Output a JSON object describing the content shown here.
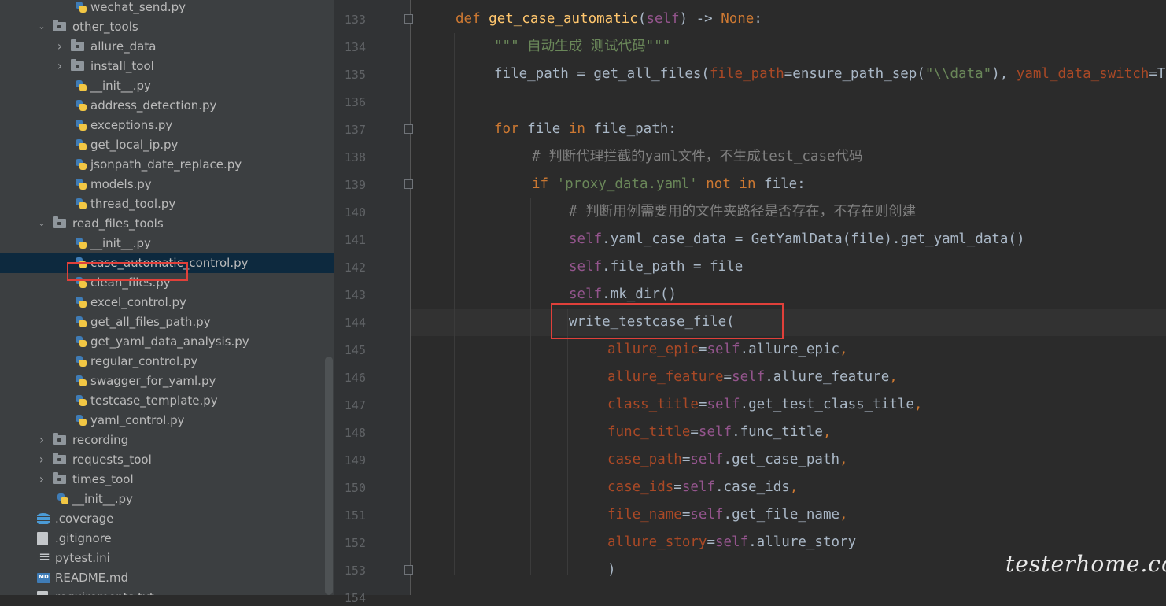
{
  "tree": {
    "items": [
      {
        "label": "wechat_send.py",
        "type": "py",
        "indent": 3
      },
      {
        "label": "other_tools",
        "type": "folder",
        "indent": 1,
        "open": true
      },
      {
        "label": "allure_data",
        "type": "folder",
        "indent": 2,
        "open": false
      },
      {
        "label": "install_tool",
        "type": "folder",
        "indent": 2,
        "open": false
      },
      {
        "label": "__init__.py",
        "type": "py",
        "indent": 3
      },
      {
        "label": "address_detection.py",
        "type": "py",
        "indent": 3
      },
      {
        "label": "exceptions.py",
        "type": "py",
        "indent": 3
      },
      {
        "label": "get_local_ip.py",
        "type": "py",
        "indent": 3
      },
      {
        "label": "jsonpath_date_replace.py",
        "type": "py",
        "indent": 3
      },
      {
        "label": "models.py",
        "type": "py",
        "indent": 3
      },
      {
        "label": "thread_tool.py",
        "type": "py",
        "indent": 3
      },
      {
        "label": "read_files_tools",
        "type": "folder",
        "indent": 1,
        "open": true
      },
      {
        "label": "__init__.py",
        "type": "py",
        "indent": 3
      },
      {
        "label": "case_automatic_control.py",
        "type": "py",
        "indent": 3,
        "selected": true
      },
      {
        "label": "clean_files.py",
        "type": "py",
        "indent": 3,
        "highlighted": true
      },
      {
        "label": "excel_control.py",
        "type": "py",
        "indent": 3
      },
      {
        "label": "get_all_files_path.py",
        "type": "py",
        "indent": 3
      },
      {
        "label": "get_yaml_data_analysis.py",
        "type": "py",
        "indent": 3
      },
      {
        "label": "regular_control.py",
        "type": "py",
        "indent": 3
      },
      {
        "label": "swagger_for_yaml.py",
        "type": "py",
        "indent": 3
      },
      {
        "label": "testcase_template.py",
        "type": "py",
        "indent": 3
      },
      {
        "label": "yaml_control.py",
        "type": "py",
        "indent": 3
      },
      {
        "label": "recording",
        "type": "folder",
        "indent": 1,
        "open": false
      },
      {
        "label": "requests_tool",
        "type": "folder",
        "indent": 1,
        "open": false
      },
      {
        "label": "times_tool",
        "type": "folder",
        "indent": 1,
        "open": false
      },
      {
        "label": "__init__.py",
        "type": "py",
        "indent": 2
      },
      {
        "label": ".coverage",
        "type": "db",
        "indent": 0
      },
      {
        "label": ".gitignore",
        "type": "file",
        "indent": 0
      },
      {
        "label": "pytest.ini",
        "type": "ini",
        "indent": 0
      },
      {
        "label": "README.md",
        "type": "md",
        "indent": 0
      },
      {
        "label": "requirements.txt",
        "type": "file",
        "indent": 0
      }
    ]
  },
  "editor": {
    "lines": [
      {
        "num": "133",
        "fold": true,
        "indent": 1,
        "tokens": [
          [
            "kw",
            "def "
          ],
          [
            "fn",
            "get_case_automatic"
          ],
          [
            "df",
            "("
          ],
          [
            "sf",
            "self"
          ],
          [
            "df",
            ") -> "
          ],
          [
            "kw",
            "None"
          ],
          [
            "df",
            ":"
          ]
        ]
      },
      {
        "num": "134",
        "indent": 2,
        "tokens": [
          [
            "st",
            "\"\"\" 自动生成 测试代码\"\"\""
          ]
        ]
      },
      {
        "num": "135",
        "indent": 2,
        "tokens": [
          [
            "df",
            "file_path = get_all_files("
          ],
          [
            "pa",
            "file_path"
          ],
          [
            "df",
            "=ensure_path_sep("
          ],
          [
            "st",
            "\"\\\\data\""
          ],
          [
            "df",
            "), "
          ],
          [
            "pa",
            "yaml_data_switch"
          ],
          [
            "df",
            "=True)"
          ]
        ]
      },
      {
        "num": "136",
        "indent": 0,
        "tokens": []
      },
      {
        "num": "137",
        "fold": true,
        "indent": 2,
        "tokens": [
          [
            "kw",
            "for "
          ],
          [
            "df",
            "file "
          ],
          [
            "kw",
            "in "
          ],
          [
            "df",
            "file_path:"
          ]
        ]
      },
      {
        "num": "138",
        "indent": 3,
        "tokens": [
          [
            "cm",
            "# 判断代理拦截的yaml文件，不生成test_case代码"
          ]
        ]
      },
      {
        "num": "139",
        "fold": true,
        "indent": 3,
        "tokens": [
          [
            "kw",
            "if "
          ],
          [
            "st",
            "'proxy_data.yaml'"
          ],
          [
            "kw",
            " not in "
          ],
          [
            "df",
            "file:"
          ]
        ]
      },
      {
        "num": "140",
        "indent": 4,
        "tokens": [
          [
            "cm",
            "# 判断用例需要用的文件夹路径是否存在，不存在则创建"
          ]
        ]
      },
      {
        "num": "141",
        "indent": 4,
        "tokens": [
          [
            "sf",
            "self"
          ],
          [
            "df",
            ".yaml_case_data = GetYamlData(file).get_yaml_data()"
          ]
        ]
      },
      {
        "num": "142",
        "indent": 4,
        "tokens": [
          [
            "sf",
            "self"
          ],
          [
            "df",
            ".file_path = file"
          ]
        ]
      },
      {
        "num": "143",
        "indent": 4,
        "tokens": [
          [
            "sf",
            "self"
          ],
          [
            "df",
            ".mk_dir()"
          ]
        ]
      },
      {
        "num": "144",
        "indent": 4,
        "current": true,
        "tokens": [
          [
            "df",
            "write_testcase_file("
          ]
        ]
      },
      {
        "num": "145",
        "indent": 5,
        "tokens": [
          [
            "pa",
            "allure_epic"
          ],
          [
            "df",
            "="
          ],
          [
            "sf",
            "self"
          ],
          [
            "df",
            ".allure_epic"
          ],
          [
            "kw",
            ","
          ]
        ]
      },
      {
        "num": "146",
        "indent": 5,
        "tokens": [
          [
            "pa",
            "allure_feature"
          ],
          [
            "df",
            "="
          ],
          [
            "sf",
            "self"
          ],
          [
            "df",
            ".allure_feature"
          ],
          [
            "kw",
            ","
          ]
        ]
      },
      {
        "num": "147",
        "indent": 5,
        "tokens": [
          [
            "pa",
            "class_title"
          ],
          [
            "df",
            "="
          ],
          [
            "sf",
            "self"
          ],
          [
            "df",
            ".get_test_class_title"
          ],
          [
            "kw",
            ","
          ]
        ]
      },
      {
        "num": "148",
        "indent": 5,
        "tokens": [
          [
            "pa",
            "func_title"
          ],
          [
            "df",
            "="
          ],
          [
            "sf",
            "self"
          ],
          [
            "df",
            ".func_title"
          ],
          [
            "kw",
            ","
          ]
        ]
      },
      {
        "num": "149",
        "indent": 5,
        "tokens": [
          [
            "pa",
            "case_path"
          ],
          [
            "df",
            "="
          ],
          [
            "sf",
            "self"
          ],
          [
            "df",
            ".get_case_path"
          ],
          [
            "kw",
            ","
          ]
        ]
      },
      {
        "num": "150",
        "indent": 5,
        "tokens": [
          [
            "pa",
            "case_ids"
          ],
          [
            "df",
            "="
          ],
          [
            "sf",
            "self"
          ],
          [
            "df",
            ".case_ids"
          ],
          [
            "kw",
            ","
          ]
        ]
      },
      {
        "num": "151",
        "indent": 5,
        "tokens": [
          [
            "pa",
            "file_name"
          ],
          [
            "df",
            "="
          ],
          [
            "sf",
            "self"
          ],
          [
            "df",
            ".get_file_name"
          ],
          [
            "kw",
            ","
          ]
        ]
      },
      {
        "num": "152",
        "indent": 5,
        "tokens": [
          [
            "pa",
            "allure_story"
          ],
          [
            "df",
            "="
          ],
          [
            "sf",
            "self"
          ],
          [
            "df",
            ".allure_story"
          ]
        ]
      },
      {
        "num": "153",
        "fold": true,
        "indent": 5,
        "tokens": [
          [
            "df",
            ")"
          ]
        ]
      },
      {
        "num": "154",
        "indent": 0,
        "tokens": []
      }
    ]
  },
  "watermark": "testerhome.com"
}
